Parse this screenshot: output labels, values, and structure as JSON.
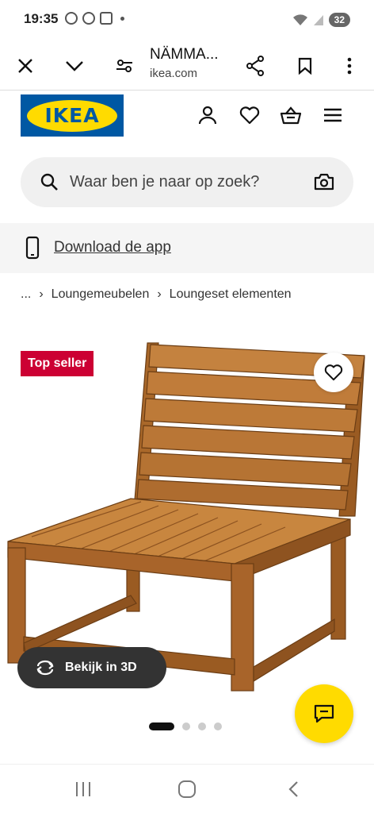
{
  "status_bar": {
    "time": "19:35",
    "battery": "32"
  },
  "browser": {
    "title": "NÄMMA...",
    "url": "ikea.com",
    "icons": [
      "close-icon",
      "chevron-down-icon",
      "site-settings-icon",
      "share-icon",
      "bookmark-icon",
      "more-icon"
    ]
  },
  "header": {
    "logo_text": "IKEA",
    "icons": [
      "account-icon",
      "wishlist-heart-icon",
      "cart-basket-icon",
      "menu-icon"
    ],
    "brand_colors": {
      "blue": "#0058a3",
      "yellow": "#ffdb00"
    }
  },
  "search": {
    "placeholder": "Waar ben je naar op zoek?"
  },
  "download": {
    "label": "Download de app"
  },
  "breadcrumb": {
    "items": [
      "...",
      "Loungemeubelen",
      "Loungeset elementen"
    ]
  },
  "product": {
    "badge": "Top seller",
    "badge_color": "#cc0033",
    "view3d_label": "Bekijk in 3D",
    "gallery": {
      "current": 1,
      "total": 4
    }
  },
  "chat": {
    "icon": "chat-icon"
  },
  "system_nav": {
    "icons": [
      "recent-apps-icon",
      "home-icon",
      "back-icon"
    ]
  }
}
